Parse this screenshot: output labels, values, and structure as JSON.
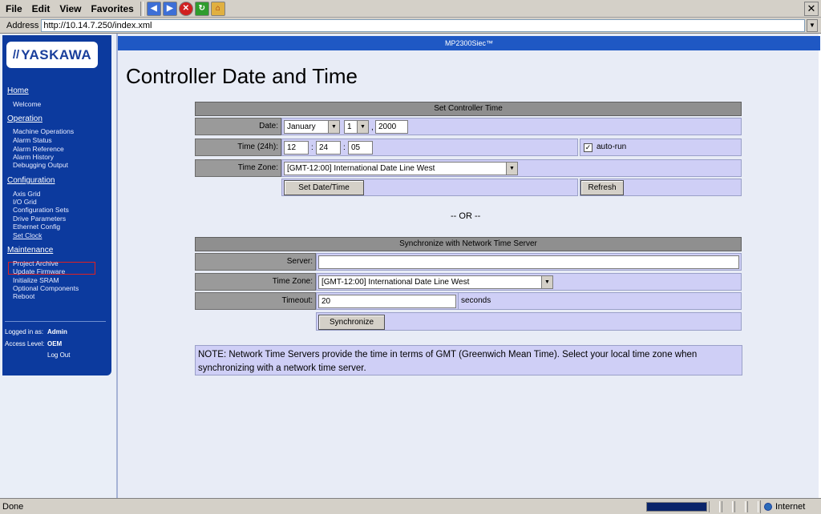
{
  "menu": {
    "file": "File",
    "edit": "Edit",
    "view": "View",
    "favorites": "Favorites"
  },
  "address": {
    "label": "Address",
    "url": "http://10.14.7.250/index.xml"
  },
  "sidebar": {
    "logo": "YASKAWA",
    "sections": [
      {
        "title": "Home",
        "items": [
          "Welcome"
        ]
      },
      {
        "title": "Operation",
        "items": [
          "Machine Operations",
          "Alarm Status",
          "Alarm Reference",
          "Alarm History",
          "Debugging Output"
        ]
      },
      {
        "title": "Configuration",
        "items": [
          "Axis Grid",
          "I/O Grid",
          "Configuration Sets",
          "Drive Parameters",
          "Ethernet Config",
          "Set Clock"
        ]
      },
      {
        "title": "Maintenance",
        "items": [
          "Project Archive",
          "Update Firmware",
          "Initialize SRAM",
          "Optional Components",
          "Reboot"
        ]
      }
    ],
    "logged_in_label": "Logged in as:",
    "logged_in_value": "Admin",
    "access_label": "Access Level:",
    "access_value": "OEM",
    "logout": "Log Out"
  },
  "banner": "MP2300Siec™",
  "page_title": "Controller Date and Time",
  "set_time": {
    "header": "Set Controller Time",
    "date_label": "Date:",
    "month": "January",
    "day": "1",
    "year": "2000",
    "time_label": "Time (24h):",
    "hour": "12",
    "minute": "24",
    "second": "05",
    "autorun_label": "auto-run",
    "autorun_checked": true,
    "tz_label": "Time Zone:",
    "tz_value": "[GMT-12:00] International Date Line West",
    "set_button": "Set Date/Time",
    "refresh_button": "Refresh"
  },
  "or_text": "-- OR --",
  "sync": {
    "header": "Synchronize with Network Time Server",
    "server_label": "Server:",
    "server_value": "",
    "tz_label": "Time Zone:",
    "tz_value": "[GMT-12:00] International Date Line West",
    "timeout_label": "Timeout:",
    "timeout_value": "20",
    "timeout_unit": "seconds",
    "sync_button": "Synchronize"
  },
  "note": "NOTE: Network Time Servers provide the time in terms of GMT (Greenwich Mean Time). Select your local time zone when synchronizing with a network time server.",
  "status": {
    "text": "Done",
    "zone": "Internet"
  }
}
